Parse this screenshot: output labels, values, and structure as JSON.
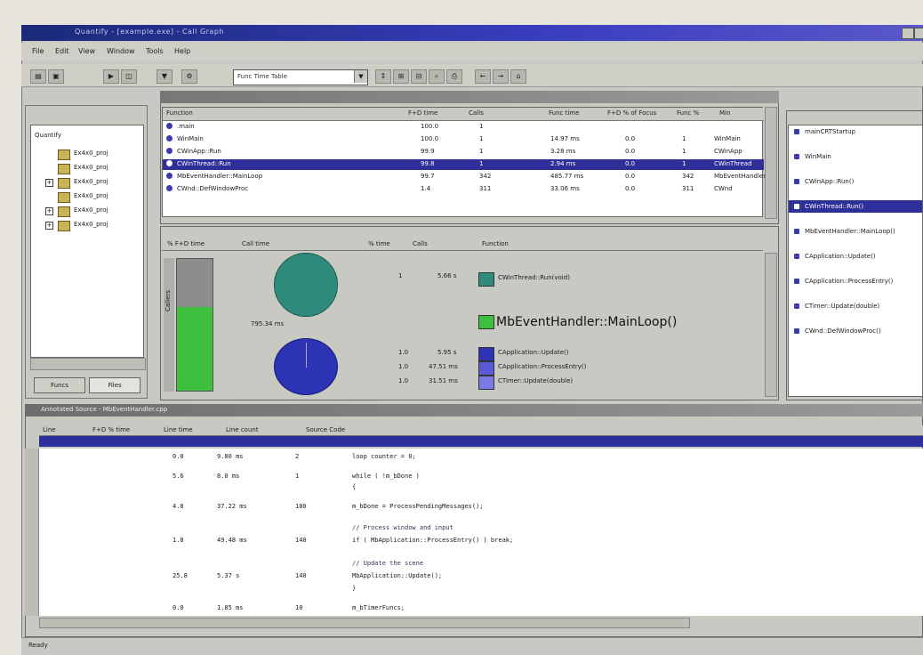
{
  "window": {
    "title": "Quantify - [example.exe] - Call Graph"
  },
  "menu": [
    "File",
    "Edit",
    "View",
    "Window",
    "Tools",
    "Help"
  ],
  "toolbar": {
    "combo_value": "Func Time Table"
  },
  "tree": {
    "root": "Quantify",
    "items": [
      "Ex4x0_proj",
      "Ex4x0_proj",
      "Ex4x0_proj",
      "Ex4x0_proj",
      "Ex4x0_proj",
      "Ex4x0_proj"
    ],
    "tabs": [
      "Funcs",
      "Files"
    ]
  },
  "functions_table": {
    "columns": [
      "Function",
      "F+D time",
      "Calls",
      "Func time",
      "F+D % of Focus",
      "Func %",
      "Min"
    ],
    "rows": [
      {
        "name": ".main",
        "c1": "100.0",
        "c2": "1",
        "c3": "",
        "c4": "",
        "c5": "",
        "c6": ""
      },
      {
        "name": "WinMain",
        "c1": "100.0",
        "c2": "1",
        "c3": "14.97 ms",
        "c4": "0.0",
        "c5": "1",
        "c6": "WinMain"
      },
      {
        "name": "CWinApp::Run",
        "c1": "99.9",
        "c2": "1",
        "c3": "3.28 ms",
        "c4": "0.0",
        "c5": "1",
        "c6": "CWinApp"
      },
      {
        "name": "CWinThread::Run",
        "c1": "99.8",
        "c2": "1",
        "c3": "2.94 ms",
        "c4": "0.0",
        "c5": "1",
        "c6": "CWinThread"
      },
      {
        "name": "MbEventHandler::MainLoop",
        "c1": "99.7",
        "c2": "342",
        "c3": "485.77 ms",
        "c4": "0.0",
        "c5": "342",
        "c6": "MbEventHandler"
      },
      {
        "name": "CWnd::DefWindowProc",
        "c1": "1.4",
        "c2": "311",
        "c3": "33.06 ms",
        "c4": "0.0",
        "c5": "311",
        "c6": "CWnd"
      }
    ]
  },
  "detail_panel": {
    "columns": [
      "% F+D time",
      "Call time",
      "% time",
      "Calls",
      "Function"
    ],
    "callers_label": "Callers",
    "current_time": "795.34 ms",
    "focus_function": "MbEventHandler::MainLoop()",
    "callers": [
      {
        "pct": "1",
        "time": "5.66 s",
        "name": "CWinThread::Run(void)"
      }
    ],
    "descendants": [
      {
        "pct": "1.0",
        "time": "5.95 s",
        "name": "CApplication::Update()"
      },
      {
        "pct": "1.0",
        "time": "47.51 ms",
        "name": "CApplication::ProcessEntry()"
      },
      {
        "pct": "1.0",
        "time": "31.51 ms",
        "name": "CTimer::Update(double)"
      }
    ],
    "colors": {
      "green_bar": "#3fbf3f",
      "teal_pie": "#2e8a7a",
      "blue_pie": "#2c33b4"
    }
  },
  "right_list": {
    "items": [
      "mainCRTStartup",
      "WinMain",
      "CWinApp::Run()",
      "CWinThread::Run()",
      "MbEventHandler::MainLoop()",
      "CApplication::Update()",
      "CApplication::ProcessEntry()",
      "CTimer::Update(double)",
      "CWnd::DefWindowProc()"
    ]
  },
  "source": {
    "title": "Annotated Source - MbEventHandler.cpp",
    "columns": [
      "Line",
      "F+D % time",
      "Line time",
      "Line count",
      "Source Code"
    ],
    "lines": [
      {
        "pct": "0.0",
        "time": "9.80 ms",
        "count": "2",
        "code": "loop     counter = 0;"
      },
      {
        "pct": "5.6",
        "time": "8.0 ms",
        "count": "1",
        "code": "while ( !m_bDone )"
      },
      {
        "pct": "",
        "time": "",
        "count": "",
        "code": "{"
      },
      {
        "pct": "4.8",
        "time": "37.22 ms",
        "count": "180",
        "code": "    m_bDone = ProcessPendingMessages();"
      },
      {
        "pct": "",
        "time": "",
        "count": "",
        "code": "    // Process window and input"
      },
      {
        "pct": "1.8",
        "time": "49.48 ms",
        "count": "140",
        "code": "    if ( MbApplication::ProcessEntry() ) break;"
      },
      {
        "pct": "",
        "time": "",
        "count": "",
        "code": "        // Update the scene"
      },
      {
        "pct": "25.8",
        "time": "5.37 s",
        "count": "140",
        "code": "        MbApplication::Update();"
      },
      {
        "pct": "",
        "time": "",
        "count": "",
        "code": "    }"
      },
      {
        "pct": "0.0",
        "time": "1.85 ms",
        "count": "10",
        "code": "    m_bTimerFuncs;"
      }
    ]
  },
  "status": {
    "text": "Ready"
  }
}
